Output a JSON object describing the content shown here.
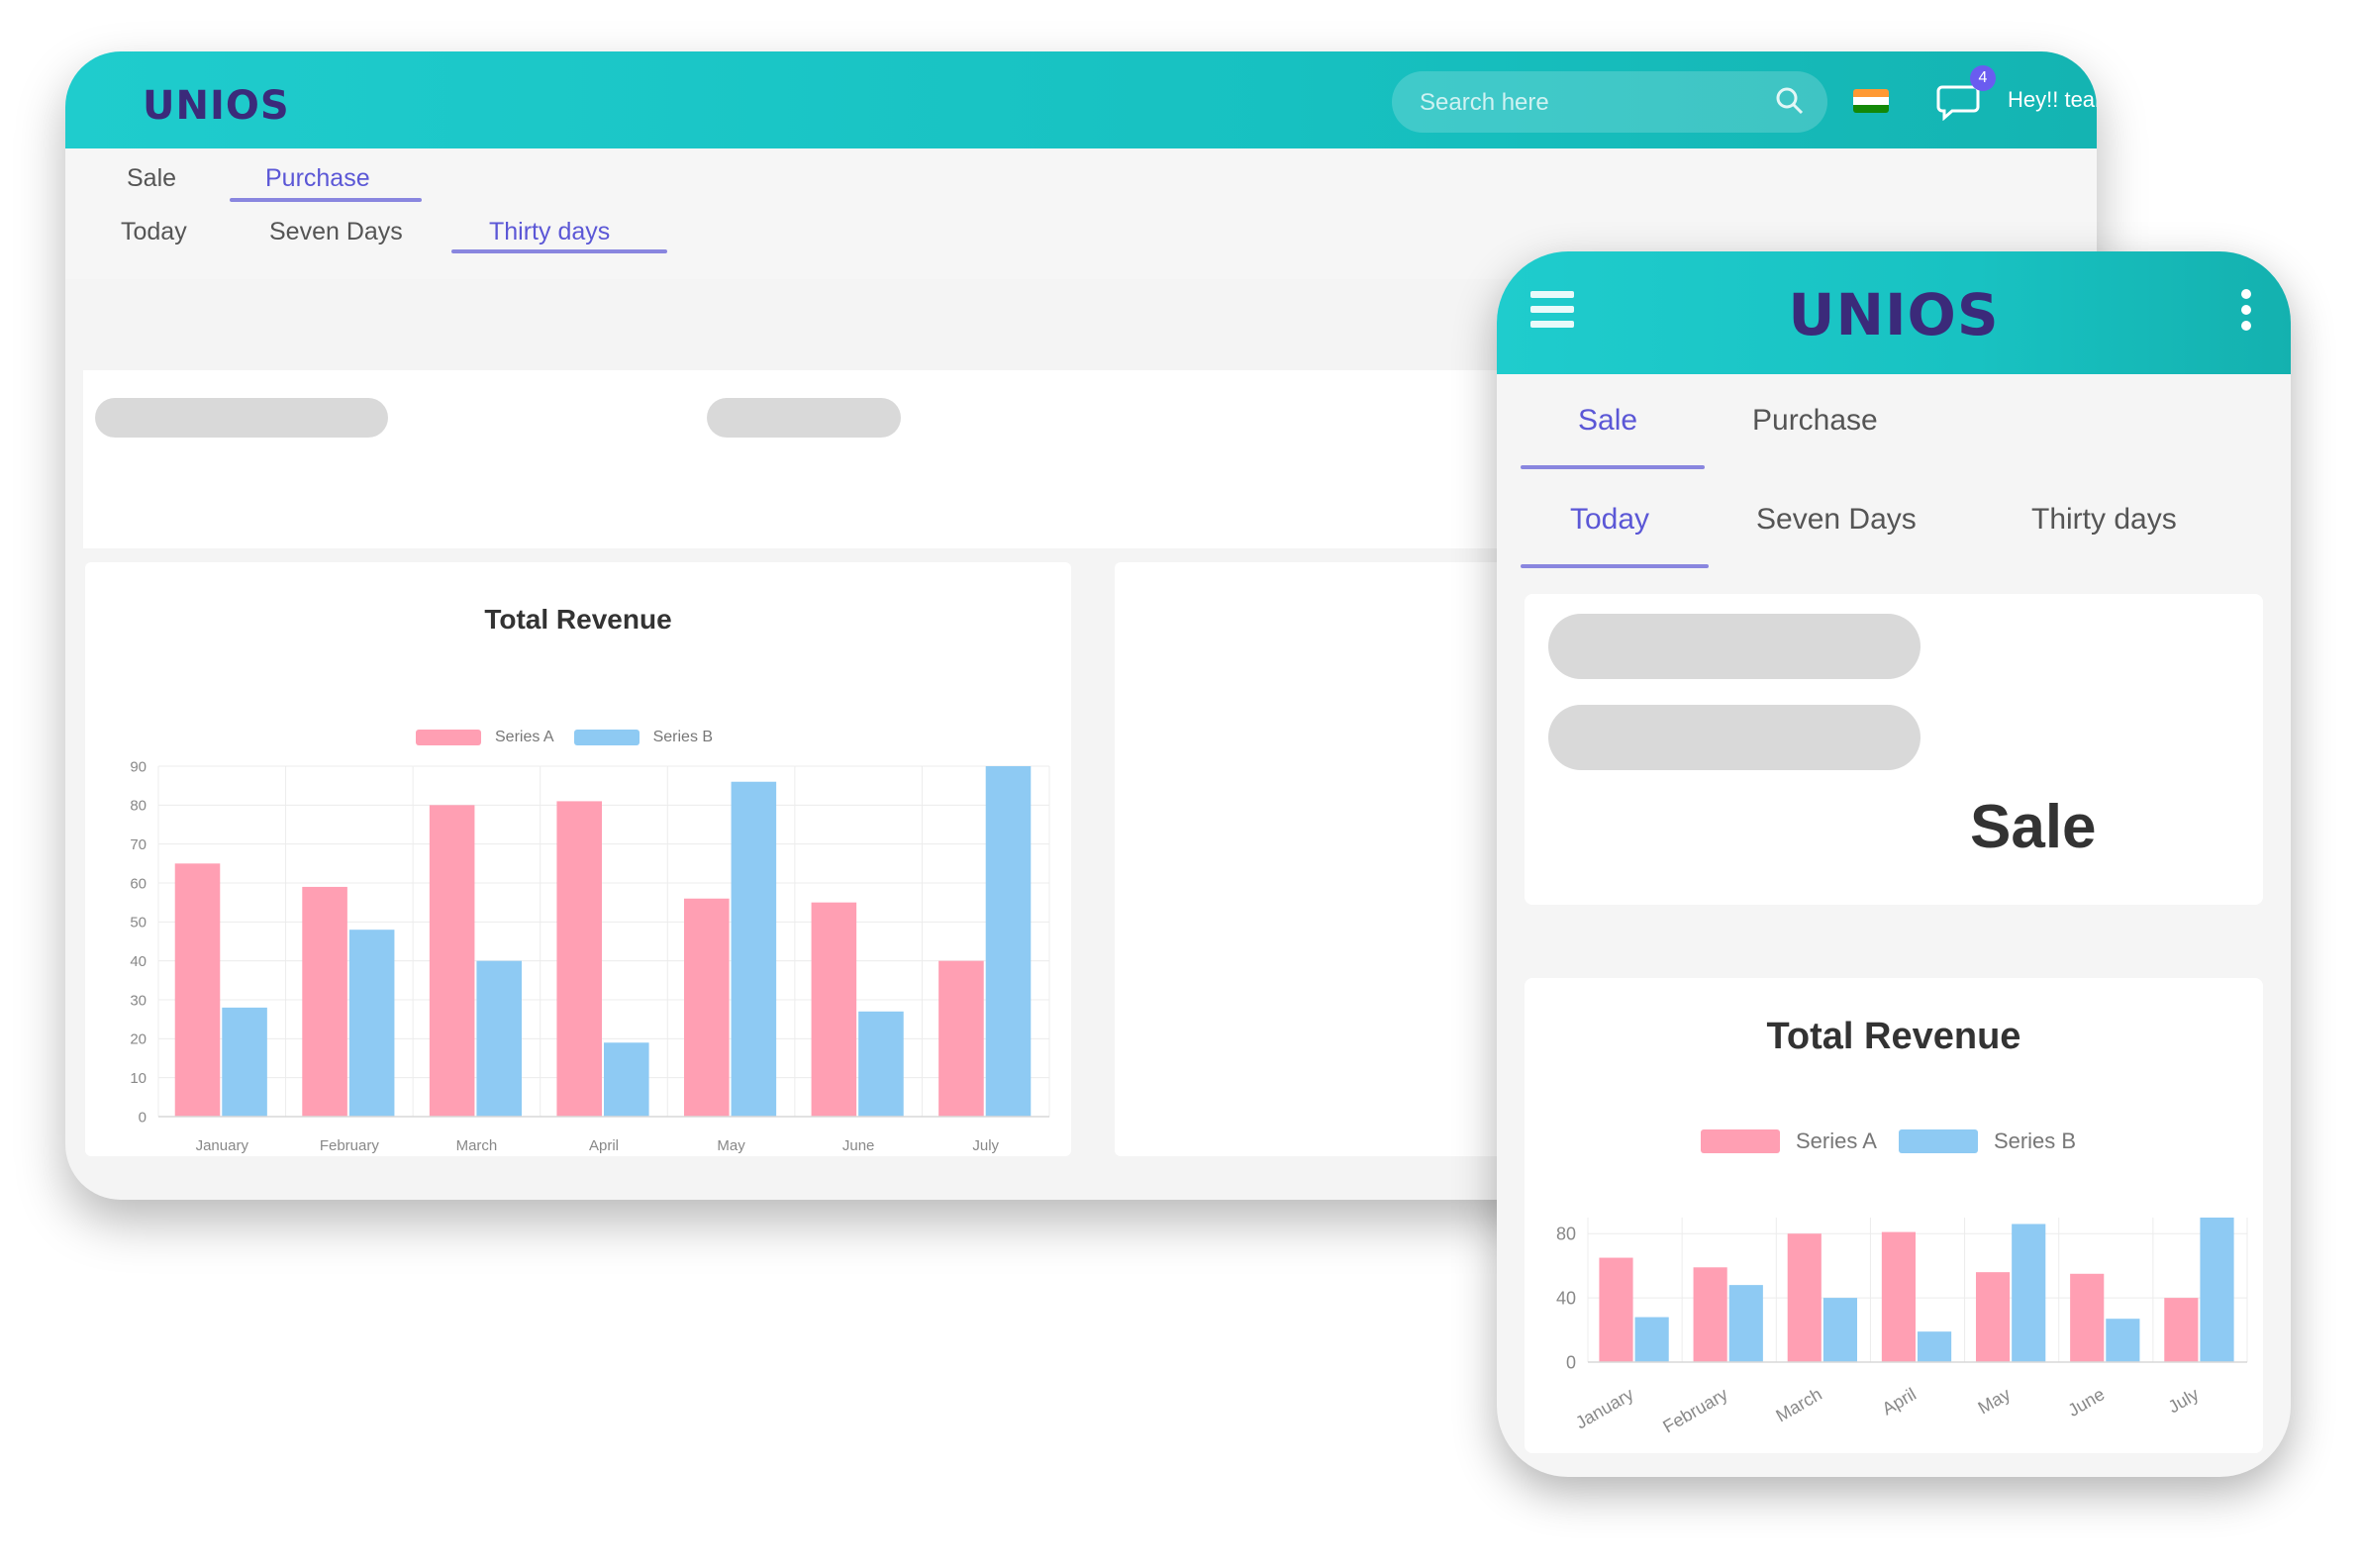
{
  "desktop": {
    "logo": "UNIOS",
    "search": {
      "placeholder": "Search here"
    },
    "notifications": {
      "count": "4"
    },
    "user": {
      "name": "Hey!! team"
    },
    "tabs": [
      {
        "label": "Sale",
        "active": false
      },
      {
        "label": "Purchase",
        "active": true
      }
    ],
    "period_tabs": [
      {
        "label": "Today",
        "active": false
      },
      {
        "label": "Seven Days",
        "active": false
      },
      {
        "label": "Thirty days",
        "active": true
      }
    ]
  },
  "mobile": {
    "logo": "UNIOS",
    "tabs": [
      {
        "label": "Sale",
        "active": true
      },
      {
        "label": "Purchase",
        "active": false
      }
    ],
    "period_tabs": [
      {
        "label": "Today",
        "active": true
      },
      {
        "label": "Seven Days",
        "active": false
      },
      {
        "label": "Thirty days",
        "active": false
      }
    ],
    "sale_heading": "Sale"
  },
  "colors": {
    "header_teal": "#1fcccd",
    "accent": "#5b57d6",
    "series_a": "#ff9fb3",
    "series_b": "#8ecaf3"
  },
  "chart_data": [
    {
      "id": "desktop-revenue",
      "type": "bar",
      "title": "Total Revenue",
      "categories": [
        "January",
        "February",
        "March",
        "April",
        "May",
        "June",
        "July"
      ],
      "series": [
        {
          "name": "Series A",
          "values": [
            65,
            59,
            80,
            81,
            56,
            55,
            40
          ]
        },
        {
          "name": "Series B",
          "values": [
            28,
            48,
            40,
            19,
            86,
            27,
            90
          ]
        }
      ],
      "yticks": [
        0,
        10,
        20,
        30,
        40,
        50,
        60,
        70,
        80,
        90
      ],
      "ylim": [
        0,
        90
      ],
      "legend": "top",
      "grid": true
    },
    {
      "id": "mobile-revenue",
      "type": "bar",
      "title": "Total Revenue",
      "categories": [
        "January",
        "February",
        "March",
        "April",
        "May",
        "June",
        "July"
      ],
      "series": [
        {
          "name": "Series A",
          "values": [
            65,
            59,
            80,
            81,
            56,
            55,
            40
          ]
        },
        {
          "name": "Series B",
          "values": [
            28,
            48,
            40,
            19,
            86,
            27,
            90
          ]
        }
      ],
      "yticks": [
        0,
        40,
        80
      ],
      "ylim": [
        0,
        90
      ],
      "legend": "top",
      "grid": true
    }
  ]
}
